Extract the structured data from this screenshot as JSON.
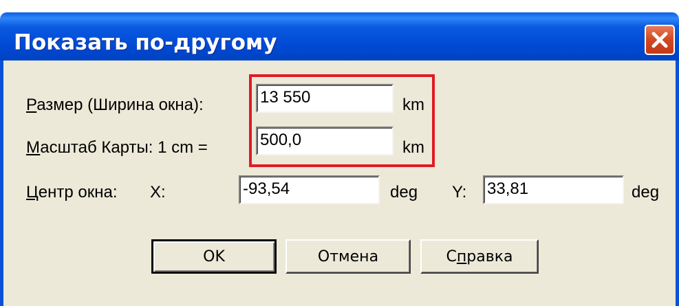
{
  "window": {
    "title": "Показать по-другому"
  },
  "size": {
    "label_first": "Р",
    "label_rest": "азмер (Ширина окна):",
    "value": "13 550",
    "unit": "km"
  },
  "scale": {
    "label_first": "М",
    "label_rest": "асштаб Карты: 1 cm =",
    "value": "500,0",
    "unit": "km"
  },
  "center": {
    "label_first": "Ц",
    "label_rest": "ентр окна:",
    "x_label": "X:",
    "x_value": "-93,54",
    "x_unit": "deg",
    "y_label": "Y:",
    "y_value": "33,81",
    "y_unit": "deg"
  },
  "buttons": {
    "ok": "OK",
    "cancel": "Отмена",
    "help_before": "С",
    "help_underlined": "п",
    "help_after": "равка"
  },
  "colors": {
    "titlebar": "#0049d4",
    "close": "#d2481f",
    "dialog_bg": "#ece9d8",
    "highlight": "#e01b24"
  }
}
